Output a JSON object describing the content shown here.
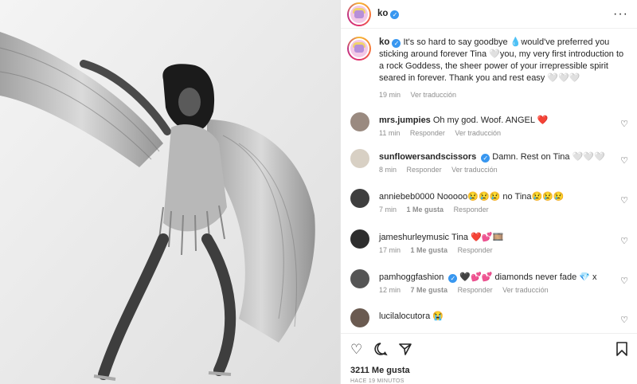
{
  "post": {
    "username": "ko",
    "caption": "It's so hard to say goodbye 💧would've preferred you sticking around forever Tina 🤍you, my very first introduction to a rock Goddess, the sheer power of your irrepressible spirit seared in forever. Thank you and rest easy 🤍🤍🤍",
    "time": "19 min",
    "see_translation": "Ver traducción"
  },
  "comments": [
    {
      "user": "mrs.jumpies",
      "text": "Oh my god. Woof. ANGEL ❤️",
      "time": "11 min",
      "reply": "Responder",
      "translate": "Ver traducción"
    },
    {
      "user": "sunflowersandscissors",
      "text": "Damn. Rest on Tina 🤍🤍🤍",
      "time": "8 min",
      "reply": "Responder",
      "translate": "Ver traducción"
    },
    {
      "user": "anniebeb0000",
      "text": "Nooooo😢😢😢 no Tina😢😢😢",
      "time": "7 min",
      "likes": "1 Me gusta",
      "reply": "Responder"
    },
    {
      "user": "jameshurleymusic",
      "text": "Tina ❤️💕🎞️",
      "time": "17 min",
      "likes": "1 Me gusta",
      "reply": "Responder"
    },
    {
      "user": "pamhoggfashion",
      "text": "🖤💕💕 diamonds never fade 💎 x",
      "time": "12 min",
      "likes": "7 Me gusta",
      "reply": "Responder",
      "translate": "Ver traducción"
    },
    {
      "user": "lucilalocutora",
      "text": "😭",
      "time": "",
      "reply": ""
    }
  ],
  "footer": {
    "likes": "3211 Me gusta",
    "time_ago": "HACE 19 MINUTOS"
  },
  "icons": {
    "like": "heart-icon",
    "comment": "comment-icon",
    "share": "share-icon",
    "save": "bookmark-icon",
    "more": "more-icon"
  }
}
